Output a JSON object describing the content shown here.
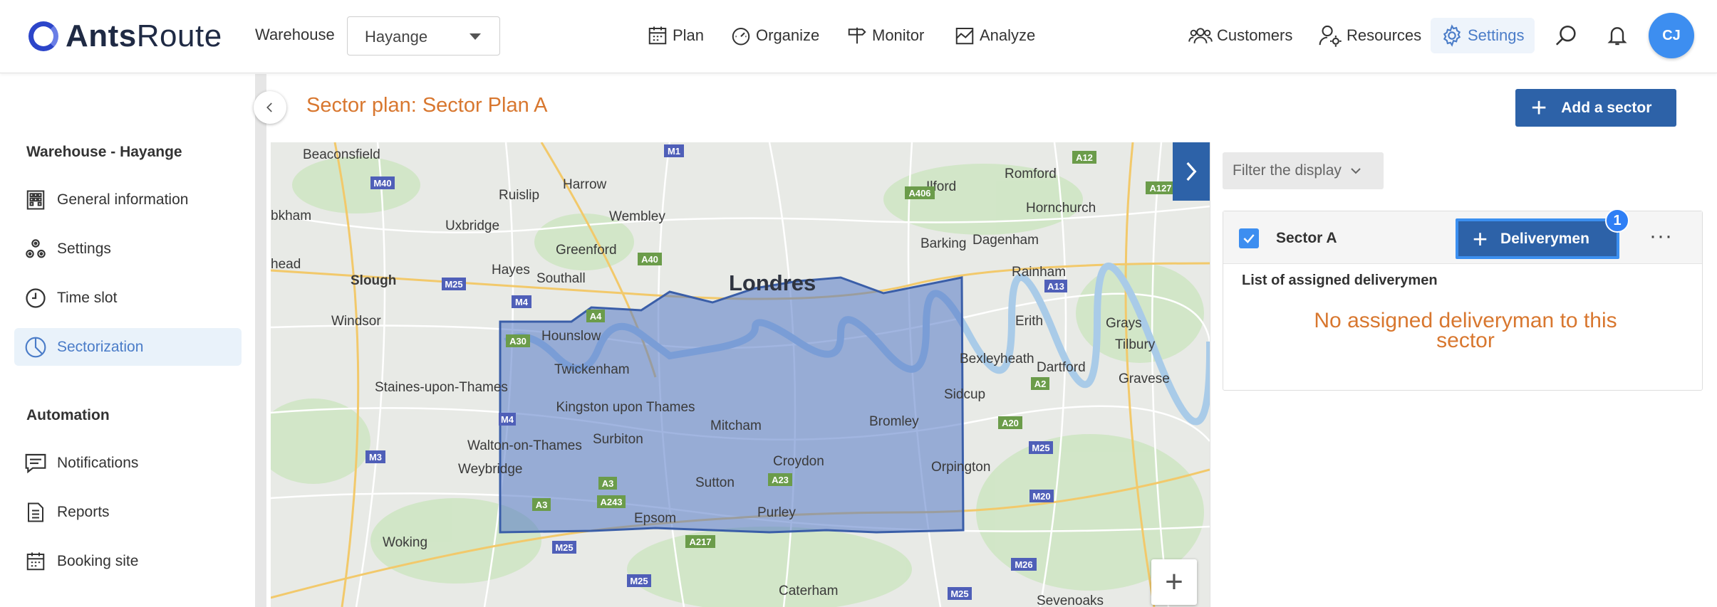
{
  "app": {
    "logo_bold": "Ants",
    "logo_light": "Route",
    "brand_color": "#2c45c9"
  },
  "header": {
    "warehouse_label": "Warehouse",
    "warehouse_value": "Hayange",
    "nav": [
      {
        "label": "Plan",
        "icon": "calendar-icon"
      },
      {
        "label": "Organize",
        "icon": "gauge-icon"
      },
      {
        "label": "Monitor",
        "icon": "signpost-icon"
      },
      {
        "label": "Analyze",
        "icon": "chart-icon"
      }
    ],
    "right_nav": [
      {
        "label": "Customers",
        "icon": "users-icon"
      },
      {
        "label": "Resources",
        "icon": "user-gear-icon"
      },
      {
        "label": "Settings",
        "icon": "gear-icon",
        "active": true
      }
    ],
    "avatar_initials": "CJ"
  },
  "sidebar": {
    "section1": "Warehouse - Hayange",
    "items": [
      {
        "label": "General information",
        "icon": "building-icon"
      },
      {
        "label": "Settings",
        "icon": "settings-nodes-icon"
      },
      {
        "label": "Time slot",
        "icon": "clock-icon"
      },
      {
        "label": "Sectorization",
        "icon": "pie-icon",
        "active": true
      }
    ],
    "section2": "Automation",
    "items2": [
      {
        "label": "Notifications",
        "icon": "message-icon"
      },
      {
        "label": "Reports",
        "icon": "document-icon"
      },
      {
        "label": "Booking site",
        "icon": "calendar-grid-icon"
      }
    ]
  },
  "main": {
    "title": "Sector plan: Sector Plan A",
    "add_sector_label": "Add a sector",
    "filter_label": "Filter the display",
    "sector": {
      "name": "Sector A",
      "deliverymen_label": "Deliverymen",
      "badge": "1",
      "list_label": "List of assigned deliverymen",
      "empty_message": "No assigned deliveryman to this sector"
    }
  },
  "map": {
    "places": [
      "Beaconsfield",
      "Harrow",
      "Ruislip",
      "Wembley",
      "Ilford",
      "Romford",
      "Hornchurch",
      "Uxbridge",
      "Barking",
      "Dagenham",
      "Hayes",
      "Greenford",
      "Southall",
      "Slough",
      "Londres",
      "Rainham",
      "Windsor",
      "Hounslow",
      "Erith",
      "Grays",
      "Twickenham",
      "Bexleyheath",
      "Dartford",
      "Tilbury",
      "Staines-upon-Thames",
      "Kingston upon Thames",
      "Sidcup",
      "Gravese",
      "Mitcham",
      "Bromley",
      "Surbiton",
      "Walton-on-Thames",
      "Croydon",
      "Weybridge",
      "Orpington",
      "Sutton",
      "Purley",
      "Epsom",
      "Woking",
      "Caterham",
      "Sevenoaks",
      "bkham",
      "head"
    ],
    "roads_blue": [
      "M1",
      "M40",
      "M25",
      "M4",
      "M3",
      "M20",
      "M26",
      "A13"
    ],
    "roads_green": [
      "A12",
      "A406",
      "A127",
      "A40",
      "A4",
      "A30",
      "A2",
      "A20",
      "A3",
      "A243",
      "A23",
      "A217"
    ],
    "sector_color": "#5478c7"
  }
}
